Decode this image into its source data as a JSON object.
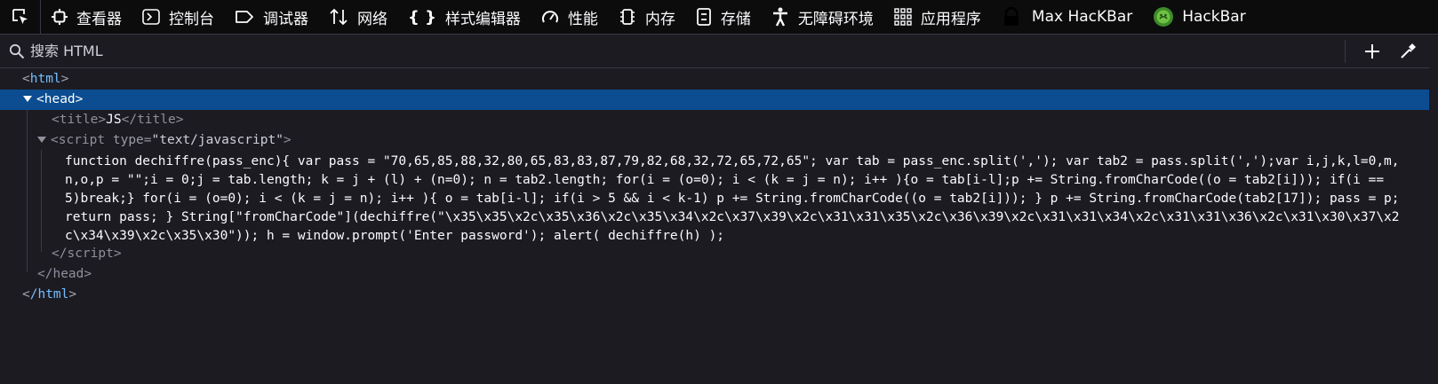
{
  "toolbar": {
    "tabs": [
      {
        "label": "查看器",
        "icon": "inspector-icon"
      },
      {
        "label": "控制台",
        "icon": "console-icon"
      },
      {
        "label": "调试器",
        "icon": "debugger-icon"
      },
      {
        "label": "网络",
        "icon": "network-icon"
      },
      {
        "label": "样式编辑器",
        "icon": "style-editor-icon"
      },
      {
        "label": "性能",
        "icon": "performance-icon"
      },
      {
        "label": "内存",
        "icon": "memory-icon"
      },
      {
        "label": "存储",
        "icon": "storage-icon"
      },
      {
        "label": "无障碍环境",
        "icon": "accessibility-icon"
      },
      {
        "label": "应用程序",
        "icon": "application-icon"
      },
      {
        "label": "Max HacKBar",
        "icon": "max-hackbar-icon"
      },
      {
        "label": "HackBar",
        "icon": "hackbar-icon"
      }
    ]
  },
  "search": {
    "placeholder": "搜索 HTML"
  },
  "tree": {
    "html_open": "html",
    "head_open": "head",
    "title_tag": "title",
    "title_text": "JS",
    "script_tag": "script",
    "script_attr_name": "type",
    "script_attr_value": "\"text/javascript\"",
    "script_code": "function dechiffre(pass_enc){ var pass = \"70,65,85,88,32,80,65,83,83,87,79,82,68,32,72,65,72,65\"; var tab = pass_enc.split(','); var tab2 = pass.split(',');var i,j,k,l=0,m,n,o,p = \"\";i = 0;j = tab.length; k = j + (l) + (n=0); n = tab2.length; for(i = (o=0); i < (k = j = n); i++ ){o = tab[i-l];p += String.fromCharCode((o = tab2[i])); if(i == 5)break;} for(i = (o=0); i < (k = j = n); i++ ){ o = tab[i-l]; if(i > 5 && i < k-1) p += String.fromCharCode((o = tab2[i])); } p += String.fromCharCode(tab2[17]); pass = p;return pass; } String[\"fromCharCode\"](dechiffre(\"\\x35\\x35\\x2c\\x35\\x36\\x2c\\x35\\x34\\x2c\\x37\\x39\\x2c\\x31\\x31\\x35\\x2c\\x36\\x39\\x2c\\x31\\x31\\x34\\x2c\\x31\\x31\\x36\\x2c\\x31\\x30\\x37\\x2c\\x34\\x39\\x2c\\x35\\x30\")); h = window.prompt('Enter password'); alert( dechiffre(h) );",
    "script_close": "/script",
    "head_close": "/head",
    "html_close": "/html"
  },
  "colors": {
    "toolbar_bg": "#0c0c0d",
    "panel_bg": "#1c1b22",
    "selection_bg": "#0b4d90",
    "tag_color": "#75bfff"
  }
}
